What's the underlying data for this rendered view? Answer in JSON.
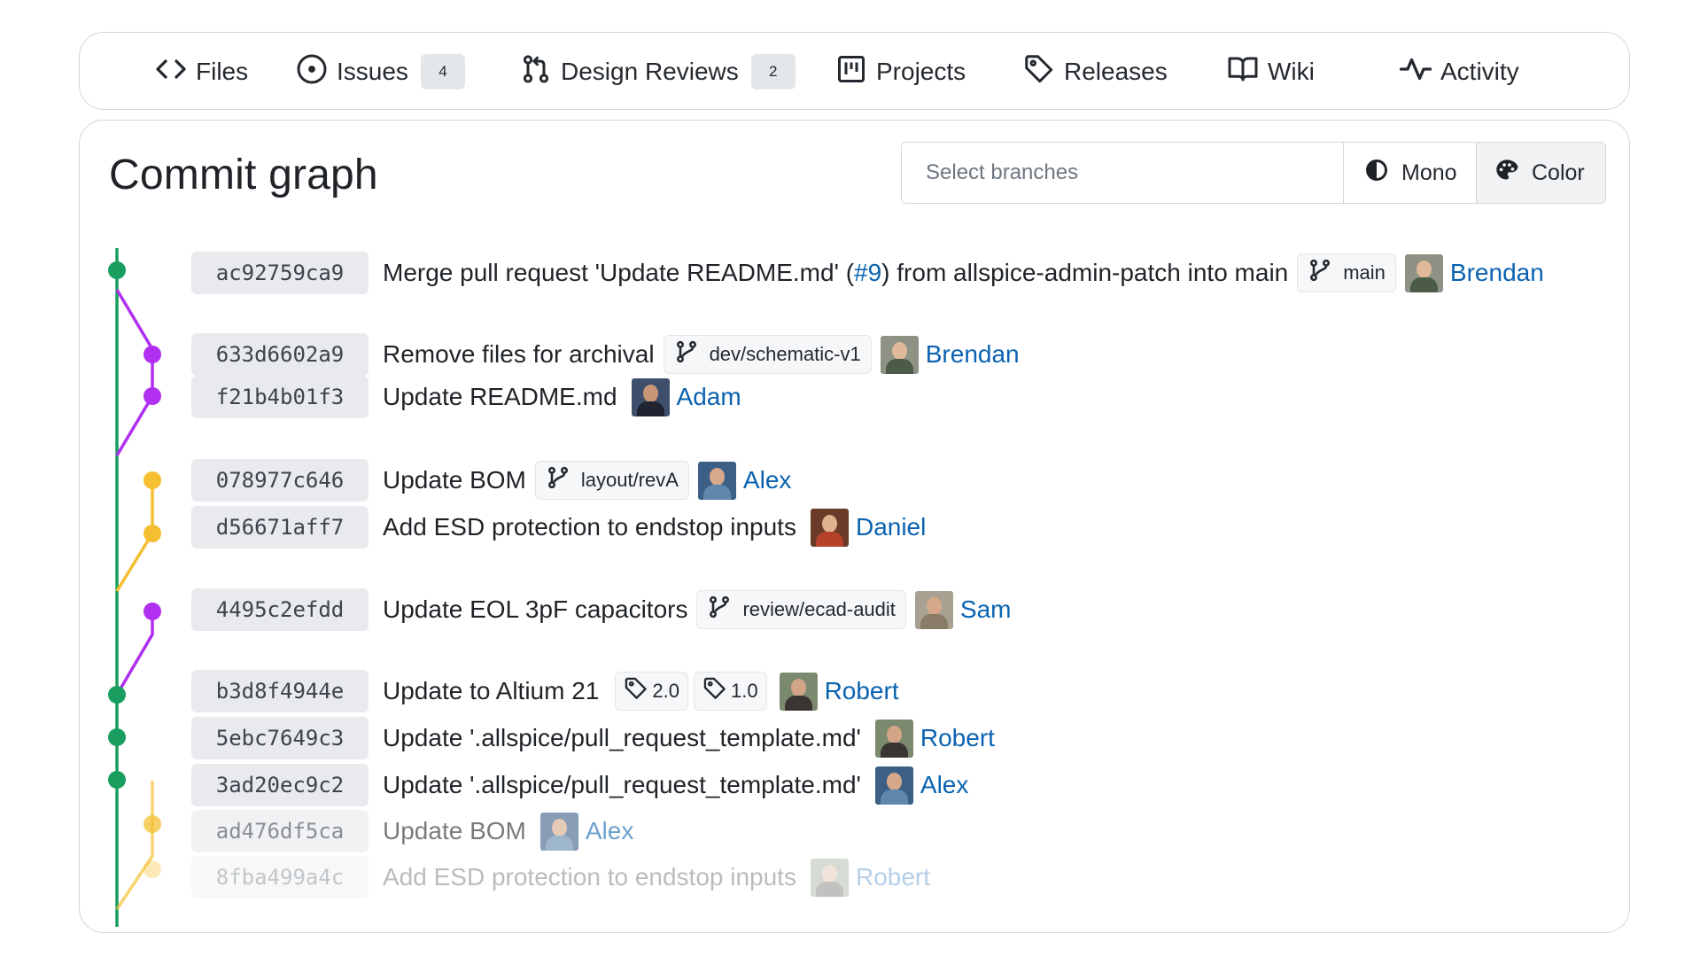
{
  "nav": {
    "items": [
      {
        "label": "Files",
        "icon": "code-icon"
      },
      {
        "label": "Issues",
        "icon": "issue-opened-icon",
        "badge": "4"
      },
      {
        "label": "Design Reviews",
        "icon": "git-pull-request-icon",
        "badge": "2"
      },
      {
        "label": "Projects",
        "icon": "project-icon"
      },
      {
        "label": "Releases",
        "icon": "tag-icon"
      },
      {
        "label": "Wiki",
        "icon": "book-icon"
      },
      {
        "label": "Activity",
        "icon": "pulse-icon"
      }
    ]
  },
  "page": {
    "title": "Commit graph",
    "branch_select_placeholder": "Select branches",
    "mono_label": "Mono",
    "color_label": "Color"
  },
  "colors": {
    "main": "#1a9e60",
    "purple": "#b02ff0",
    "yellow": "#f5bf31",
    "link": "#0a62b0"
  },
  "commits": [
    {
      "sha": "ac92759ca9",
      "message_prefix": "Merge pull request 'Update README.md' (",
      "pr_link": "#9",
      "message_suffix": ") from allspice-admin-patch into main",
      "branch": "main",
      "author": "Brendan"
    },
    {
      "sha": "633d6602a9",
      "message": "Remove files for archival",
      "branch": "dev/schematic-v1",
      "author": "Brendan"
    },
    {
      "sha": "f21b4b01f3",
      "message": "Update README.md",
      "author": "Adam"
    },
    {
      "sha": "078977c646",
      "message": "Update BOM",
      "branch": "layout/revA",
      "author": "Alex"
    },
    {
      "sha": "d56671aff7",
      "message": "Add ESD protection to endstop inputs",
      "author": "Daniel"
    },
    {
      "sha": "4495c2efdd",
      "message": "Update EOL 3pF capacitors",
      "branch": "review/ecad-audit",
      "author": "Sam"
    },
    {
      "sha": "b3d8f4944e",
      "message": "Update to Altium 21",
      "tags": [
        "2.0",
        "1.0"
      ],
      "author": "Robert"
    },
    {
      "sha": "5ebc7649c3",
      "message": "Update '.allspice/pull_request_template.md'",
      "author": "Robert"
    },
    {
      "sha": "3ad20ec9c2",
      "message": "Update '.allspice/pull_request_template.md'",
      "author": "Alex"
    },
    {
      "sha": "ad476df5ca",
      "message": "Update BOM",
      "author": "Alex"
    },
    {
      "sha": "8fba499a4c",
      "message": "Add ESD protection to endstop inputs",
      "author": "Robert"
    }
  ]
}
